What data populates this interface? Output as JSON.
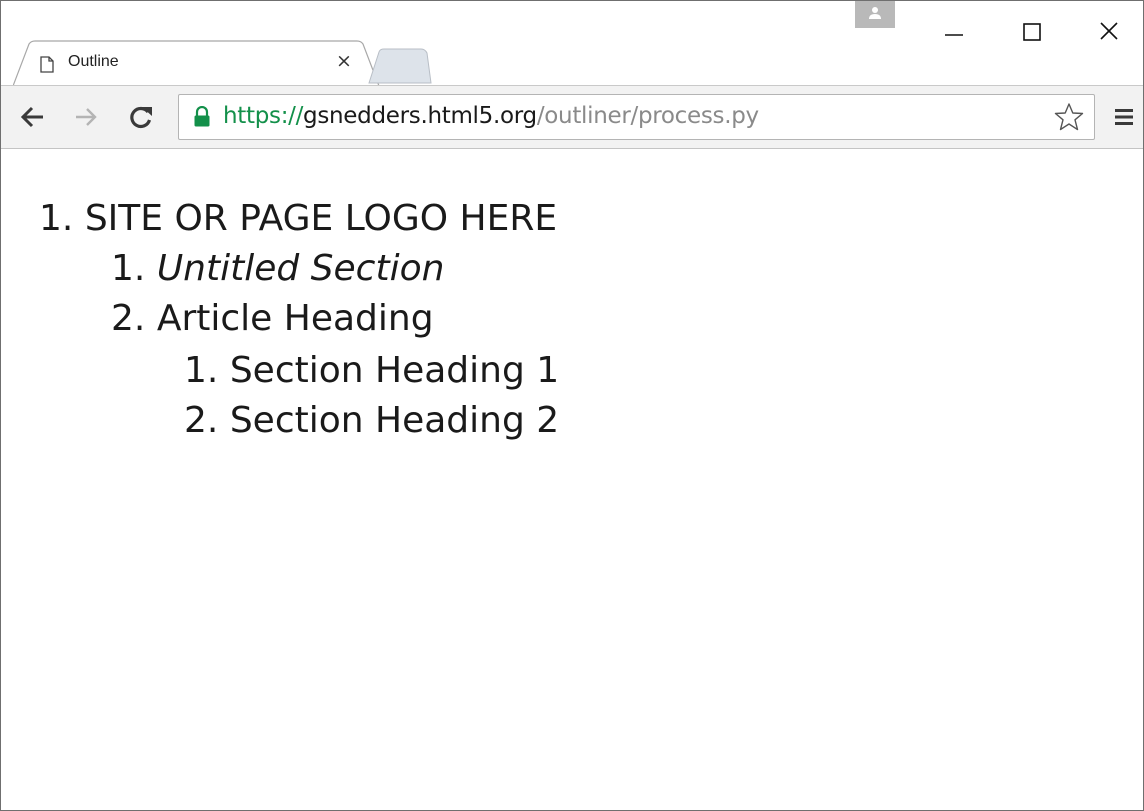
{
  "browser": {
    "tab": {
      "title": "Outline",
      "close_glyph": "×"
    },
    "icons": {
      "tab_page": "page-icon",
      "profile": "person-icon",
      "minimize": "minimize-icon",
      "maximize": "maximize-icon",
      "close": "close-icon",
      "back": "arrow-left-icon",
      "forward": "arrow-right-icon",
      "reload": "reload-icon",
      "lock": "lock-icon",
      "bookmark": "star-icon",
      "menu": "hamburger-menu-icon"
    },
    "address_bar": {
      "scheme": "https://",
      "host": "gsnedders.html5.org",
      "path": "/outliner/process.py"
    },
    "colors": {
      "secure_green": "#13904a",
      "toolbar_bg": "#f2f2f2",
      "profile_bg": "#b9b9b9"
    }
  },
  "outline": [
    {
      "number": "1.",
      "text": "SITE OR PAGE LOGO HERE",
      "level": 1,
      "italic": false
    },
    {
      "number": "1.",
      "text": "Untitled Section",
      "level": 2,
      "italic": true
    },
    {
      "number": "2.",
      "text": "Article Heading",
      "level": 2,
      "italic": false
    },
    {
      "number": "1.",
      "text": "Section Heading 1",
      "level": 3,
      "italic": false
    },
    {
      "number": "2.",
      "text": "Section Heading 2",
      "level": 3,
      "italic": false
    }
  ]
}
